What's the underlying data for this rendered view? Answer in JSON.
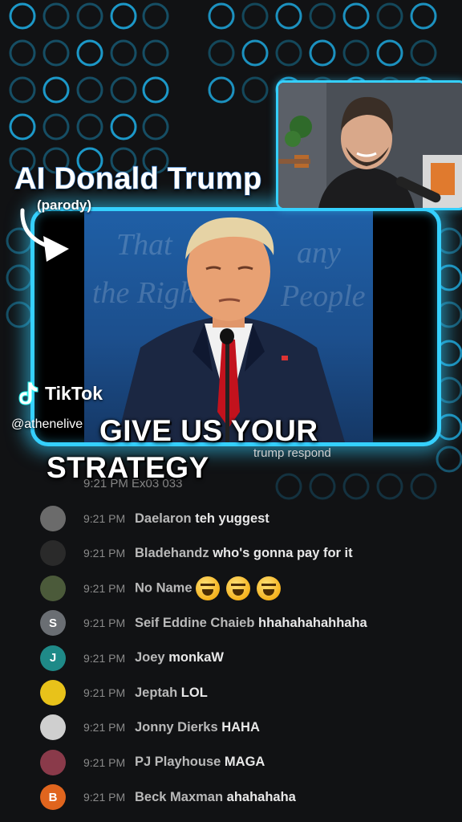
{
  "colors": {
    "accent": "#35d0ff",
    "background": "#111214"
  },
  "overlay": {
    "title": "AI Donald Trump",
    "subtitle": "(parody)",
    "tiktok_label": "TikTok",
    "handle": "@athenelive",
    "caption_line1": "GIVE US YOUR",
    "caption_line2": "STRATEGY",
    "behind_caption": "trump respond",
    "partial_chat": "9:21 PM  Ex03 033"
  },
  "stage_words": [
    "That",
    "any",
    "the Right",
    "People"
  ],
  "chat": {
    "messages": [
      {
        "time": "9:21 PM",
        "user": "Daelaron",
        "text": "teh yuggest",
        "avatar": "",
        "avatar_color": "#6b6b6b"
      },
      {
        "time": "9:21 PM",
        "user": "Bladehandz",
        "text": "who's gonna pay for it",
        "avatar": "",
        "avatar_color": "#2a2a2a"
      },
      {
        "time": "9:21 PM",
        "user": "No Name",
        "text": "",
        "emoji_count": 3,
        "avatar": "",
        "avatar_color": "#4b5a3a"
      },
      {
        "time": "9:21 PM",
        "user": "Seif Eddine Chaieb",
        "text": "hhahahahahhaha",
        "avatar": "S",
        "avatar_color": "#6a6e73"
      },
      {
        "time": "9:21 PM",
        "user": "Joey",
        "text": "monkaW",
        "avatar": "J",
        "avatar_color": "#1f8a88"
      },
      {
        "time": "9:21 PM",
        "user": "Jeptah",
        "text": "LOL",
        "avatar": "",
        "avatar_color": "#e8c21a"
      },
      {
        "time": "9:21 PM",
        "user": "Jonny Dierks",
        "text": "HAHA",
        "avatar": "",
        "avatar_color": "#cfcfcf"
      },
      {
        "time": "9:21 PM",
        "user": "PJ Playhouse",
        "text": "MAGA",
        "avatar": "",
        "avatar_color": "#8a3a4a"
      },
      {
        "time": "9:21 PM",
        "user": "Beck Maxman",
        "text": "ahahahaha",
        "avatar": "B",
        "avatar_color": "#e0651e"
      }
    ]
  }
}
